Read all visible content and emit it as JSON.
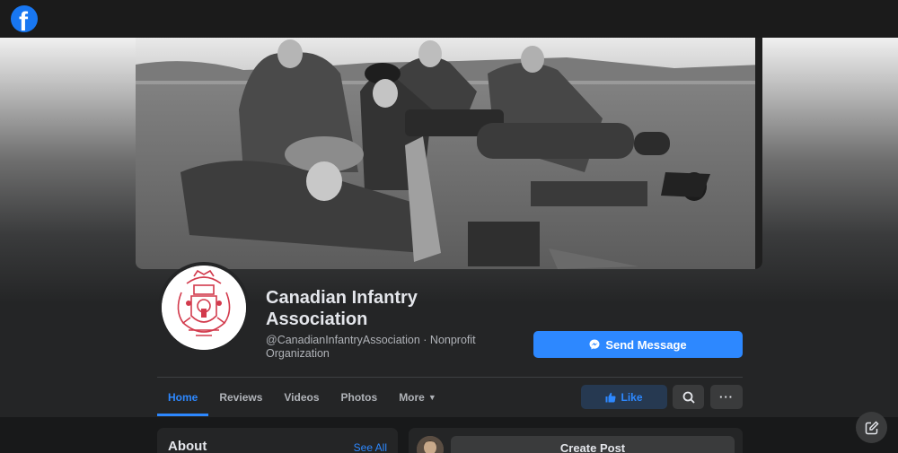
{
  "topbar": {
    "logo_icon": "facebook-logo-icon",
    "logo_letter": "f",
    "logo_color": "#1877f2"
  },
  "cover": {
    "icon": "cover-photo-image"
  },
  "profile": {
    "name": "Canadian Infantry Association",
    "handle": "@CanadianInfantryAssociation · Nonprofit Organization",
    "avatar_icon": "regimental-crest-icon"
  },
  "actions": {
    "send_message": "Send Message",
    "like": "Like",
    "more": "···",
    "accent": "#2d88ff"
  },
  "tabs": [
    {
      "label": "Home",
      "active": true
    },
    {
      "label": "Reviews"
    },
    {
      "label": "Videos"
    },
    {
      "label": "Photos"
    },
    {
      "label": "More"
    }
  ],
  "about": {
    "title": "About",
    "see_all": "See All"
  },
  "composer": {
    "create_post": "Create Post"
  }
}
